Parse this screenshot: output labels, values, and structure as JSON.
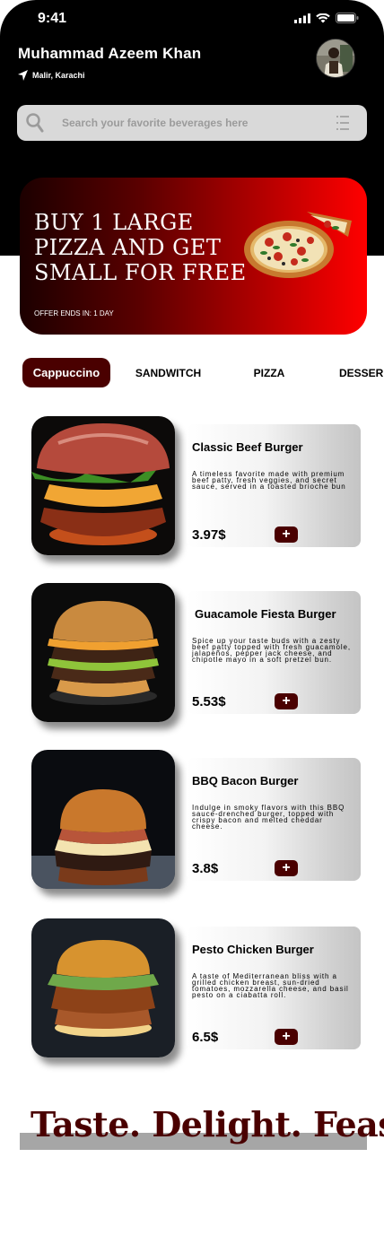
{
  "status_bar": {
    "time": "9:41"
  },
  "user": {
    "name": "Muhammad Azeem Khan",
    "location": "Malir, Karachi"
  },
  "search": {
    "placeholder": "Search your favorite beverages here"
  },
  "promo": {
    "title": "BUY 1 LARGE PIZZA AND GET SMALL FOR FREE",
    "offer": "OFFER ENDS IN: 1 DAY"
  },
  "categories": [
    "Cappuccino",
    "SANDWITCH",
    "PIZZA",
    "DESSER"
  ],
  "products": [
    {
      "name": "Classic Beef Burger",
      "description": "A timeless favorite made with premium beef patty, fresh veggies, and secret sauce, served in a toasted brioche bun",
      "price": "3.97$",
      "add_label": "+"
    },
    {
      "name": "Guacamole Fiesta Burger",
      "description": "Spice up your taste buds with a zesty beef patty topped with fresh guacamole, jalapeños, pepper jack cheese, and chipotle mayo in a soft pretzel bun.",
      "price": "5.53$",
      "add_label": "+"
    },
    {
      "name": "BBQ Bacon Burger",
      "description": "Indulge in smoky flavors with this BBQ sauce-drenched burger, topped with crispy bacon and melted cheddar cheese.",
      "price": "3.8$",
      "add_label": "+"
    },
    {
      "name": "Pesto Chicken Burger",
      "description": "A taste of Mediterranean bliss with a grilled chicken breast, sun-dried tomatoes, mozzarella cheese, and basil pesto on a ciabatta roll.",
      "price": "6.5$",
      "add_label": "+"
    }
  ],
  "tagline": "Taste. Delight. Feast",
  "colors": {
    "accent": "#4a0000",
    "promo_end": "#ff0000",
    "search_bg": "#d9d9d9"
  },
  "icons": [
    "signal-icon",
    "wifi-icon",
    "battery-icon",
    "location-arrow-icon",
    "search-icon",
    "filter-list-icon",
    "plus-icon"
  ]
}
